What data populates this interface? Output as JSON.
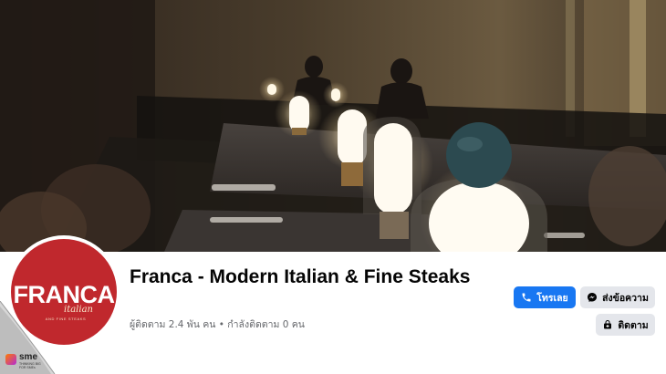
{
  "page": {
    "name": "Franca - Modern Italian & Fine Steaks",
    "followers_text": "ผู้ติดตาม 2.4 พัน คน • กำลังติดตาม 0 คน"
  },
  "avatar": {
    "brand": "FRANCA",
    "script": "italian",
    "sub": "AND FINE STEAKS"
  },
  "actions": {
    "call_label": "โทรเลย",
    "message_label": "ส่งข้อความ",
    "follow_label": "ติดตาม"
  },
  "watermark": {
    "word": "sme",
    "tag": "THINKING BIG FOR SMEs"
  },
  "colors": {
    "primary": "#1877f2",
    "secondary_button": "#e4e6eb",
    "brand_red": "#c0282d",
    "text_primary": "#050505",
    "text_secondary": "#65676b"
  },
  "icons": {
    "call": "phone-icon",
    "message": "messenger-icon",
    "follow": "follow-icon"
  }
}
